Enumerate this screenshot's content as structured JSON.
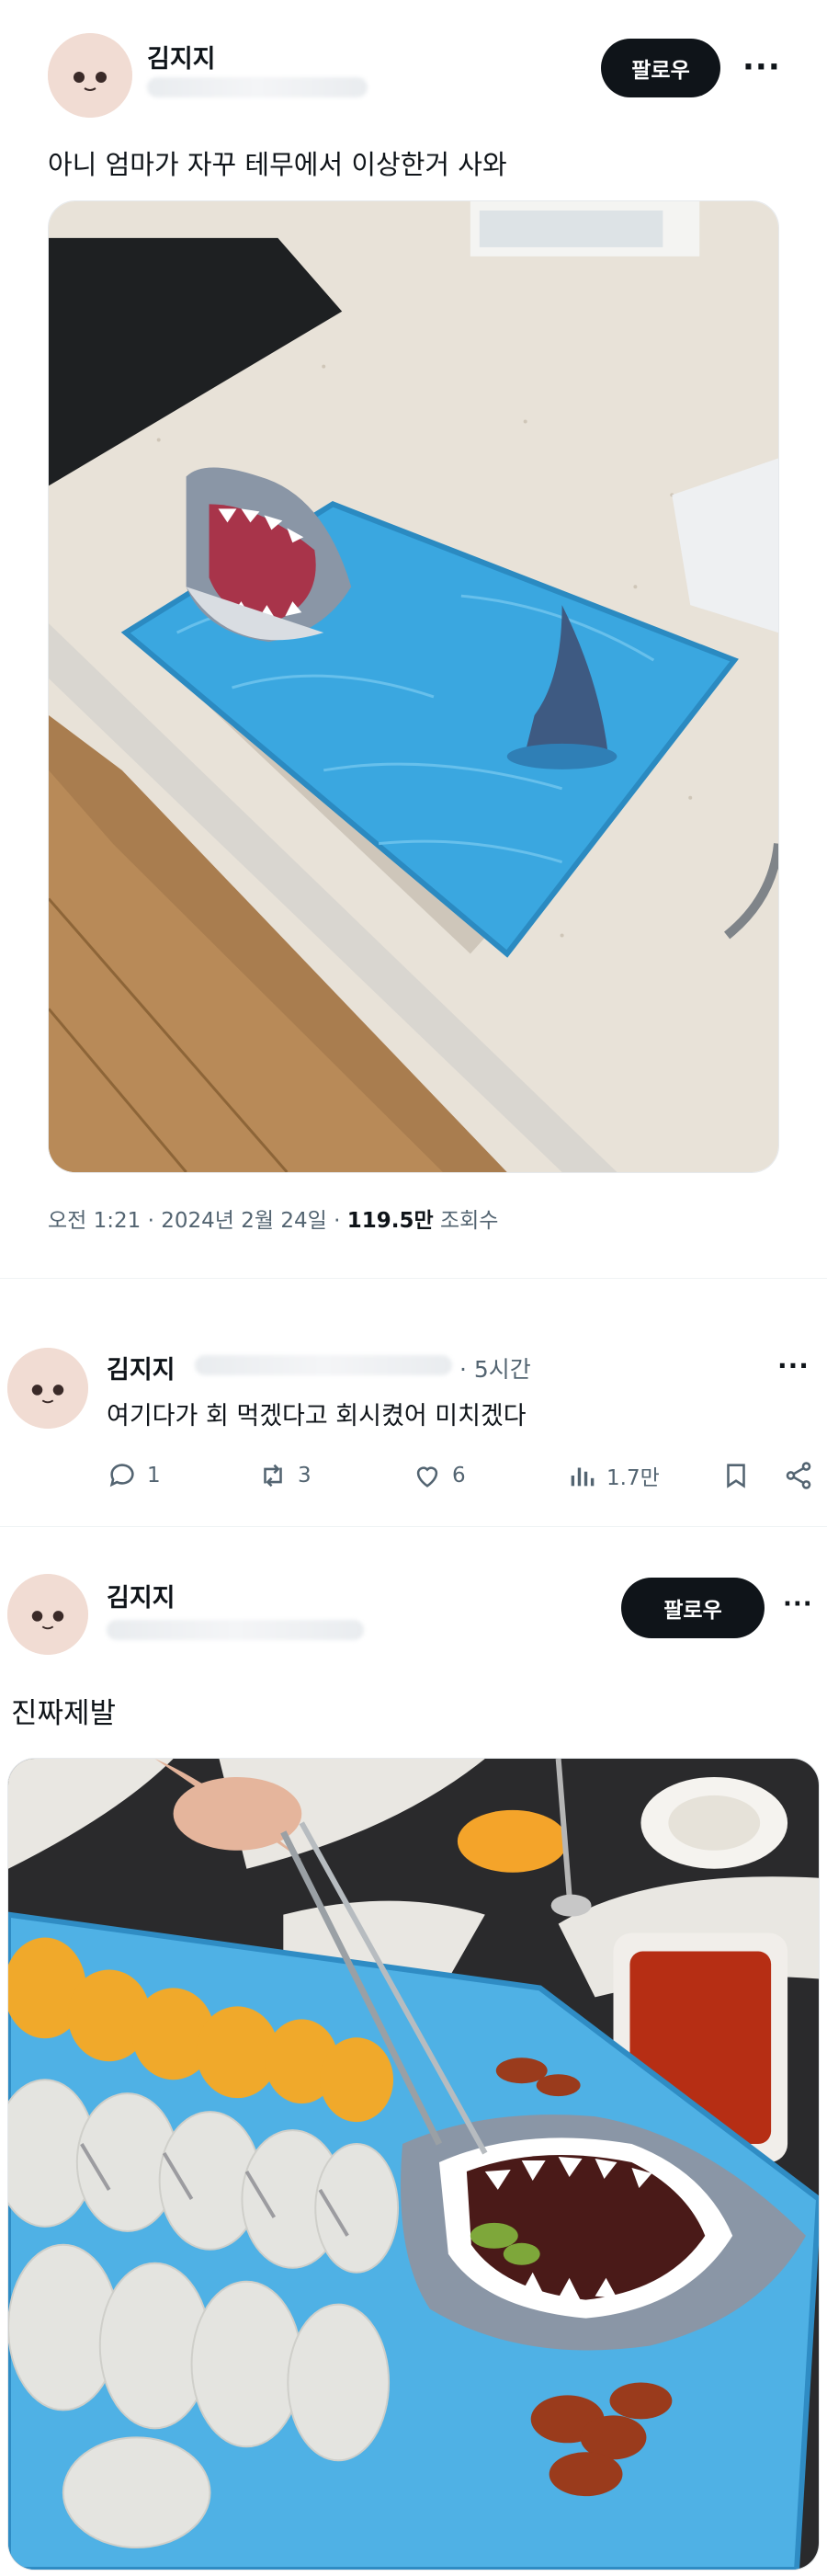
{
  "post1": {
    "author_name": "김지지",
    "follow_label": "팔로우",
    "more_label": "···",
    "text": "아니 엄마가 자꾸 테무에서 이상한거 사와",
    "meta": {
      "time": "오전 1:21",
      "separator": "·",
      "date": "2024년 2월 24일",
      "separator2": "·",
      "views_count": "119.5만",
      "views_label": "조회수"
    }
  },
  "reply": {
    "author_name": "김지지",
    "time_separator": "·",
    "time": "5시간",
    "more_label": "···",
    "text": "여기다가 회 먹겠다고 회시켰어 미치겠다",
    "actions": {
      "replies": "1",
      "reposts": "3",
      "likes": "6",
      "views": "1.7만"
    }
  },
  "post2": {
    "author_name": "김지지",
    "follow_label": "팔로우",
    "more_label": "···",
    "text": "진짜제발"
  },
  "colors": {
    "text_primary": "#0f1419",
    "text_secondary": "#536471",
    "follow_bg": "#0f1419",
    "avatar_bg": "#f1dcd3",
    "tray_blue": "#3aa7e0"
  },
  "icons": [
    "reply-icon",
    "repost-icon",
    "like-icon",
    "views-icon",
    "bookmark-icon",
    "share-icon"
  ]
}
